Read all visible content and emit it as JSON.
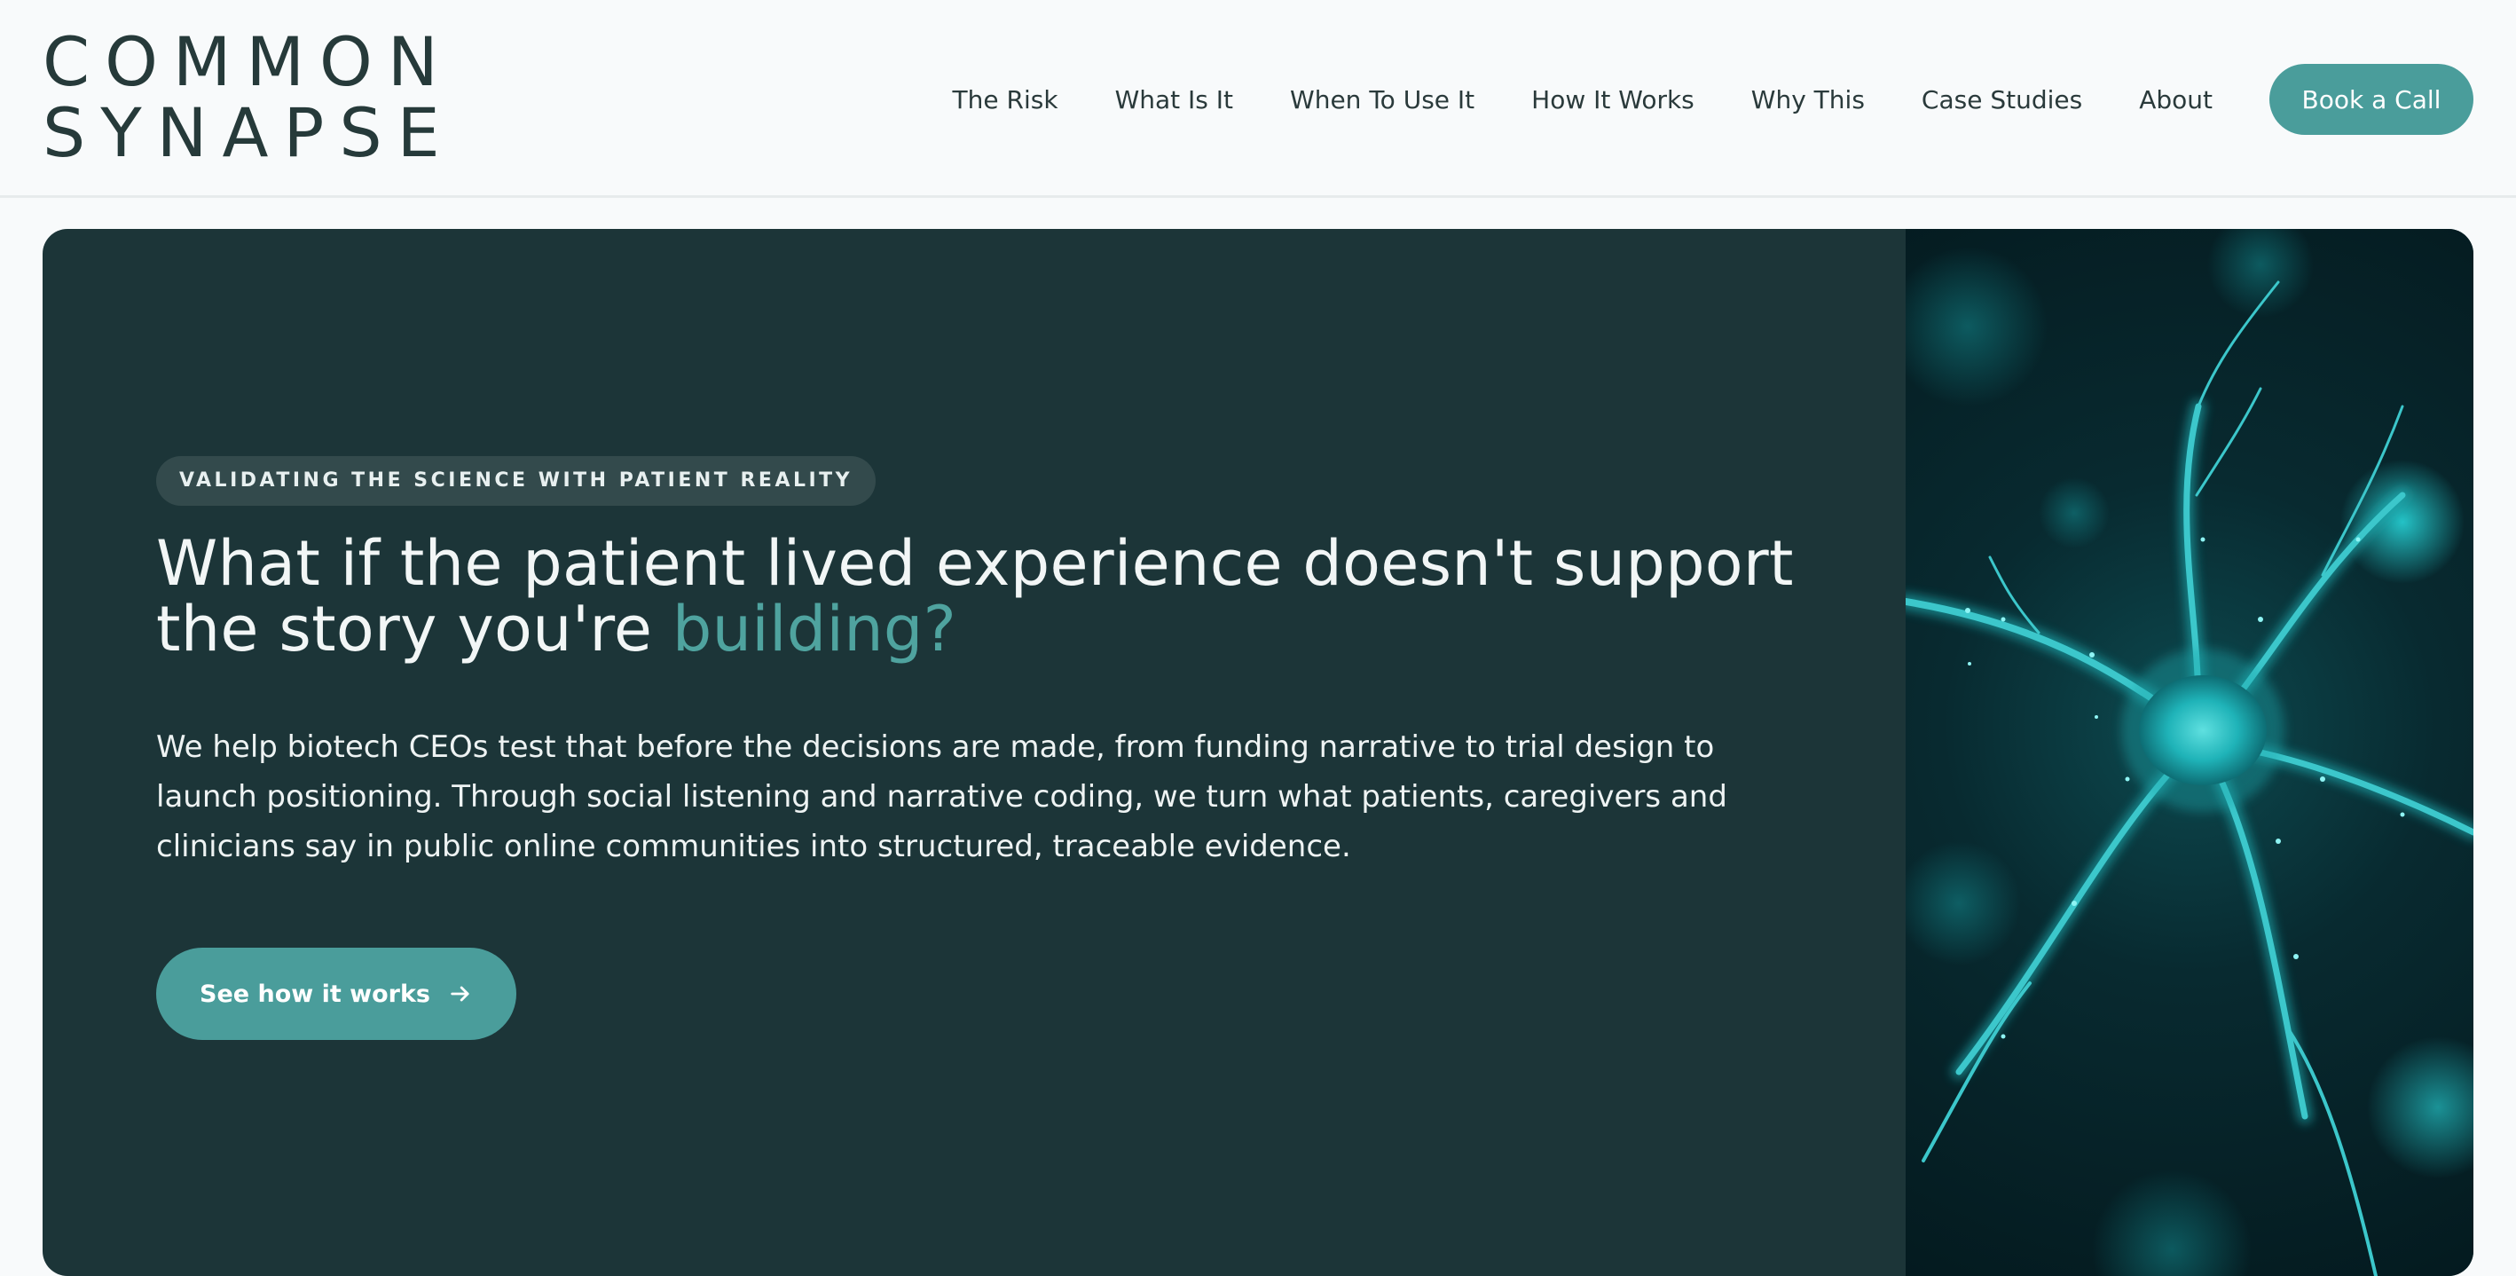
{
  "brand": {
    "line1": "COMMON",
    "line2": "SYNAPSE"
  },
  "nav": {
    "items": [
      {
        "label": "The Risk"
      },
      {
        "label": "What Is It"
      },
      {
        "label": "When To Use It"
      },
      {
        "label": "How It Works"
      },
      {
        "label": "Why This"
      },
      {
        "label": "Case Studies"
      },
      {
        "label": "About"
      }
    ],
    "cta_label": "Book a Call"
  },
  "hero": {
    "eyebrow": "VALIDATING THE SCIENCE WITH PATIENT REALITY",
    "headline_main": "What if the patient lived experience doesn't support the story you're ",
    "headline_accent": "building?",
    "body": "We help biotech CEOs test that before the decisions are made, from funding narrative to trial design to launch positioning. Through social listening and narrative coding, we turn what patients, caregivers and clinicians say in public online communities into structured, traceable evidence.",
    "cta_label": "See how it works",
    "cta_icon": "arrow-right-icon",
    "image_subject": "neuron-illustration"
  },
  "colors": {
    "background": "#f8fafb",
    "brand_text": "#263a3a",
    "hero_bg": "#1c3538",
    "accent": "#4a9d9b",
    "accent_text": "#4fa39f",
    "eyebrow_bg": "#334a4c",
    "neuron_glow": "#1fc8cc"
  }
}
